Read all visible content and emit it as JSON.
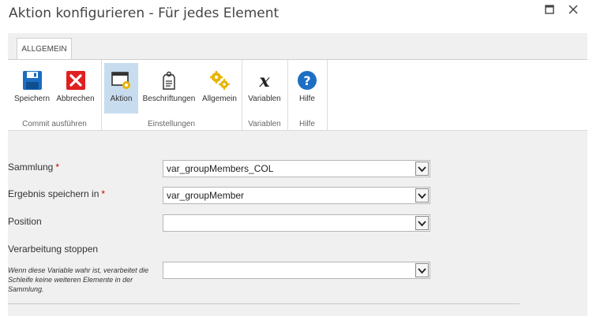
{
  "dialog": {
    "title": "Aktion konfigurieren - Für jedes Element"
  },
  "window_controls": {
    "maximize_icon": "maximize-icon",
    "close_icon": "close-icon"
  },
  "ribbon": {
    "tab": "ALLGEMEIN",
    "groups": [
      {
        "label": "Commit ausführen",
        "buttons": [
          {
            "label": "Speichern",
            "icon": "save-icon"
          },
          {
            "label": "Abbrechen",
            "icon": "cancel-icon"
          }
        ]
      },
      {
        "label": "Einstellungen",
        "buttons": [
          {
            "label": "Aktion",
            "icon": "action-settings-icon",
            "active": true
          },
          {
            "label": "Beschriftungen",
            "icon": "label-tag-icon"
          },
          {
            "label": "Allgemein",
            "icon": "gears-icon"
          }
        ]
      },
      {
        "label": "Variablen",
        "buttons": [
          {
            "label": "Variablen",
            "icon": "variable-x-icon"
          }
        ]
      },
      {
        "label": "Hilfe",
        "buttons": [
          {
            "label": "Hilfe",
            "icon": "help-icon"
          }
        ]
      }
    ]
  },
  "form": {
    "required_marker": "*",
    "fields": [
      {
        "label": "Sammlung",
        "required": true,
        "value": "var_groupMembers_COL"
      },
      {
        "label": "Ergebnis speichern in",
        "required": true,
        "value": "var_groupMember"
      },
      {
        "label": "Position",
        "required": false,
        "value": ""
      },
      {
        "label": "Verarbeitung stoppen",
        "required": false,
        "value": "",
        "hint": "Wenn diese Variable wahr ist, verarbeitet die Schleife keine weiteren Elemente in der Sammlung."
      }
    ]
  },
  "colors": {
    "save_blue": "#1b6ec2",
    "cancel_red": "#e02020",
    "help_blue": "#1e6fc4",
    "gear_gold": "#e6b400",
    "active_bg": "#c8dcef"
  }
}
